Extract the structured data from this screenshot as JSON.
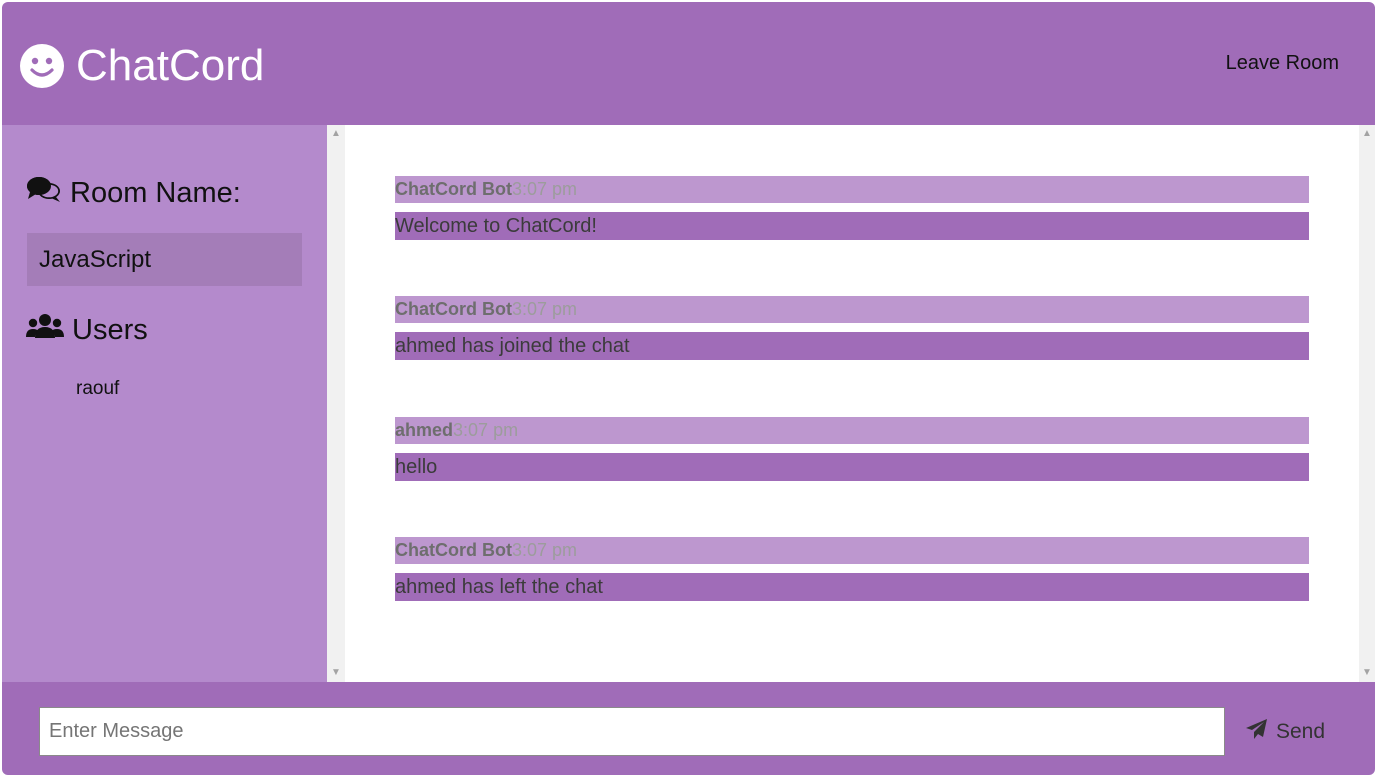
{
  "header": {
    "title": "ChatCord",
    "logo_icon": "smile-icon",
    "leave_label": "Leave Room"
  },
  "sidebar": {
    "room_heading": "Room Name:",
    "room_icon": "comments-icon",
    "room_name": "JavaScript",
    "users_heading": "Users",
    "users_icon": "users-icon",
    "users": [
      "raouf"
    ]
  },
  "messages": [
    {
      "author": "ChatCord Bot",
      "time": "3:07 pm",
      "text": "Welcome to ChatCord!"
    },
    {
      "author": "ChatCord Bot",
      "time": "3:07 pm",
      "text": "ahmed has joined the chat"
    },
    {
      "author": "ahmed",
      "time": "3:07 pm",
      "text": "hello"
    },
    {
      "author": "ChatCord Bot",
      "time": "3:07 pm",
      "text": "ahmed has left the chat"
    }
  ],
  "composer": {
    "placeholder": "Enter Message",
    "value": "",
    "send_label": "Send",
    "send_icon": "paper-plane-icon"
  },
  "colors": {
    "primary": "#a06cb8",
    "sidebar": "#b48acc",
    "meta_bar": "#bd97cf",
    "room_box": "#a47db8"
  }
}
